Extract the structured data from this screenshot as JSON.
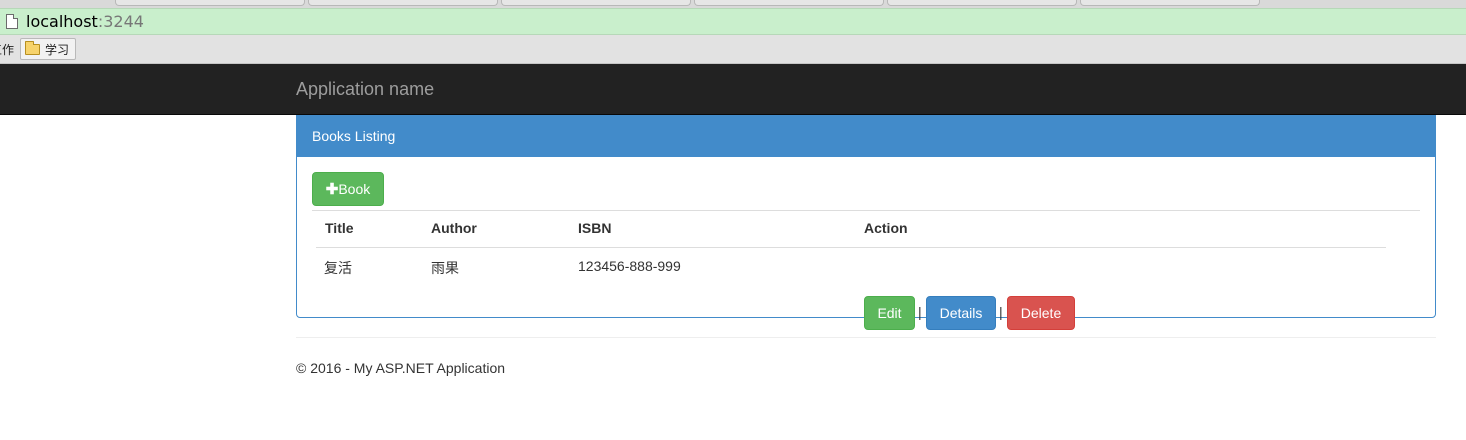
{
  "browser": {
    "url_host": "localhost",
    "url_port": ":3244",
    "bookmark_cut_label": "工作",
    "bookmark_folder_label": "学习"
  },
  "navbar": {
    "brand": "Application name"
  },
  "panel": {
    "heading": "Books Listing",
    "add_button_icon": "plus-icon",
    "add_button_label": "Book",
    "table": {
      "headers": [
        "Title",
        "Author",
        "ISBN",
        "Action"
      ],
      "rows": [
        {
          "title": "复活",
          "author": "雨果",
          "isbn": "123456-888-999",
          "actions": {
            "edit": "Edit",
            "details": "Details",
            "delete": "Delete",
            "separator": "|"
          }
        }
      ]
    }
  },
  "footer": {
    "text": "© 2016 - My ASP.NET Application"
  },
  "colors": {
    "navbar_bg": "#222222",
    "brand_text": "#9d9d9d",
    "primary": "#428bca",
    "success": "#5cb85c",
    "danger": "#d9534f",
    "address_bar_bg": "#c9efcc"
  }
}
